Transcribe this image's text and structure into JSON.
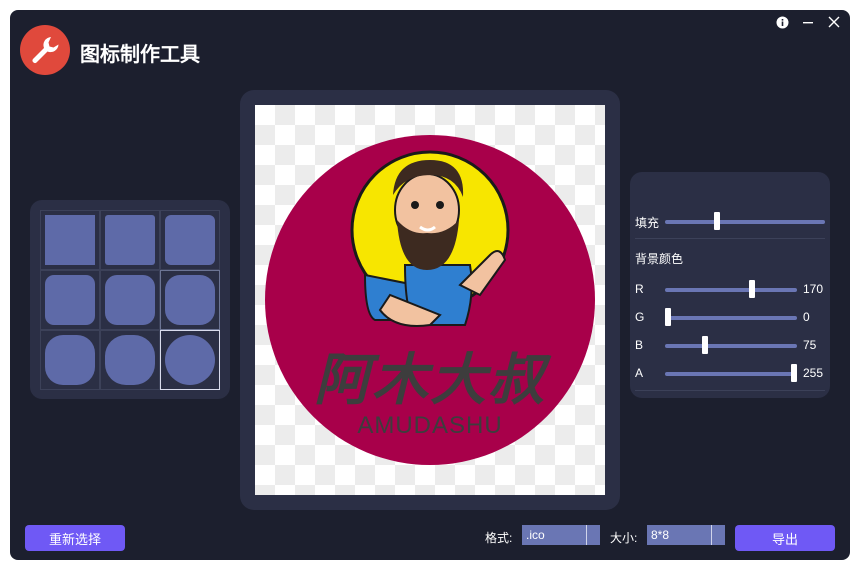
{
  "app": {
    "title": "图标制作工具"
  },
  "titlebar": {
    "info_icon": "info-icon",
    "minimize_icon": "minimize-icon",
    "close_icon": "close-icon"
  },
  "preview": {
    "brand_cn": "阿木大叔",
    "brand_en": "AMUDASHU",
    "circle_color": "#a8004a"
  },
  "settings": {
    "fill": {
      "label": "填充",
      "value": 0.32
    },
    "bg_color_label": "背景颜色",
    "channels": [
      {
        "label": "R",
        "value": "170",
        "level": 0.667
      },
      {
        "label": "G",
        "value": "0",
        "level": 0
      },
      {
        "label": "B",
        "value": "75",
        "level": 0.294
      },
      {
        "label": "A",
        "value": "255",
        "level": 1
      }
    ]
  },
  "footer": {
    "reselect_label": "重新选择",
    "format_label": "格式:",
    "format_value": ".ico",
    "size_label": "大小:",
    "size_value": "8*8",
    "export_label": "导出"
  },
  "colors": {
    "background": "#1c1f2e",
    "panel": "#2b2f45",
    "accent": "#6f59f5",
    "slider": "#6a76b4",
    "shape": "#5e6aa8"
  }
}
